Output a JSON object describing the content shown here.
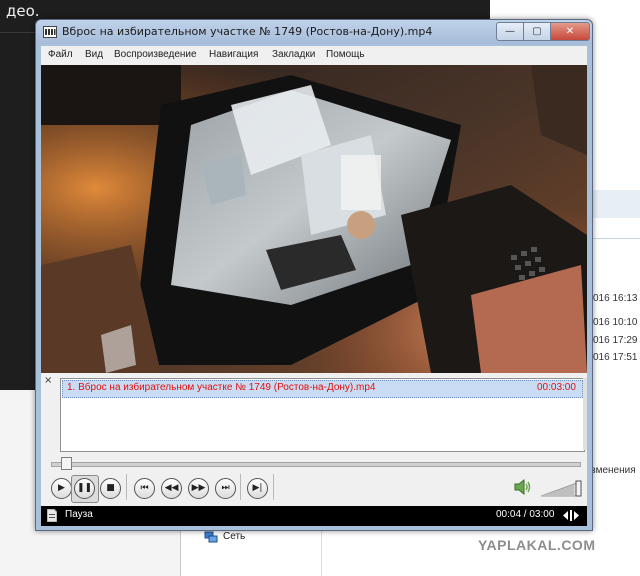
{
  "background": {
    "page_text_fragment": "део.",
    "explorer": {
      "column_header": "зменения",
      "dates": [
        "016 16:13",
        "016 10:10",
        "016 17:29",
        "016 17:51"
      ],
      "network_label": "Сеть"
    }
  },
  "player": {
    "title": "Вброс на избирательном участке № 1749 (Ростов-на-Дону).mp4",
    "window_buttons": {
      "minimize": "—",
      "maximize": "▢",
      "close": "✕"
    },
    "menu": [
      "Файл",
      "Вид",
      "Воспроизведение",
      "Навигация",
      "Закладки",
      "Помощь"
    ],
    "playlist_close": "×",
    "playlist": [
      {
        "label": "1. Вброс на избирательном участке № 1749 (Ростов-на-Дону).mp4",
        "duration": "00:03:00"
      }
    ],
    "seek_position": 0.02,
    "volume_level": 0.85,
    "controls": {
      "play": "▶",
      "pause": "❚❚",
      "stop": "■",
      "prev": "⏮",
      "rewind": "◀◀",
      "forward": "▶▶",
      "next": "⏭",
      "frame_step": "▶|"
    },
    "status": {
      "state": "Пауза",
      "time": "00:04 / 03:00"
    }
  },
  "watermark": "YAPLAKAL.COM",
  "colors": {
    "playlist_text": "#e01010",
    "titlebar": "#a9c0db",
    "statusbar": "#000000"
  }
}
